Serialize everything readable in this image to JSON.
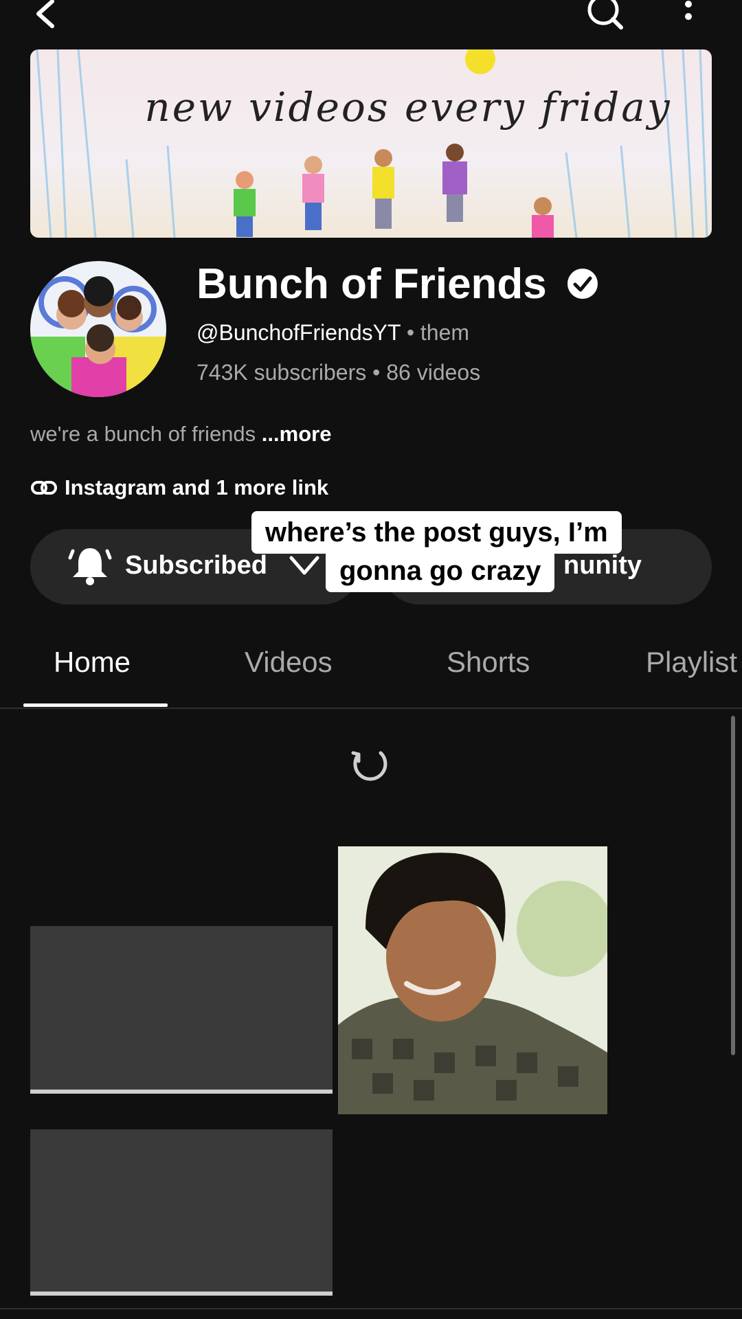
{
  "banner": {
    "text": "new videos every friday"
  },
  "channel": {
    "name": "Bunch of Friends",
    "handle": "@BunchofFriendsYT",
    "pronouns": "them",
    "subscribers": "743K subscribers",
    "videos": "86 videos",
    "description": "we're a bunch of friends",
    "more_label": "...more",
    "links": "Instagram and 1 more link"
  },
  "buttons": {
    "subscribed": "Subscribed",
    "community": "nunity"
  },
  "caption": {
    "line1": "where’s the post guys, I’m",
    "line2": "gonna go crazy"
  },
  "tabs": [
    "Home",
    "Videos",
    "Shorts",
    "Playlist"
  ],
  "active_tab": "Home",
  "colors": {
    "background": "#101010",
    "button": "#272727",
    "muted_text": "#aaaaaa"
  }
}
